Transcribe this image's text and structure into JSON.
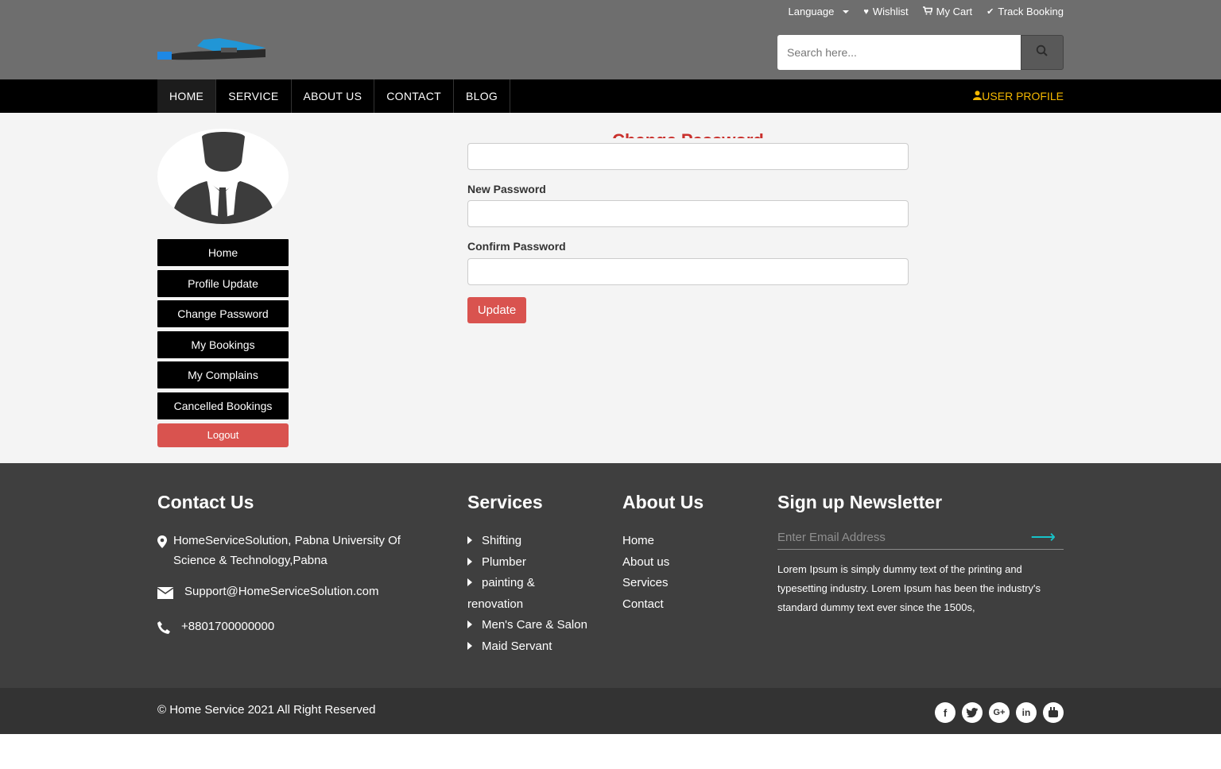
{
  "header": {
    "top_links": [
      {
        "label": "Language",
        "icon": "chevron-down-icon"
      },
      {
        "label": "Wishlist",
        "icon": "heart-icon"
      },
      {
        "label": "My Cart",
        "icon": "cart-icon"
      },
      {
        "label": "Track Booking",
        "icon": "check-icon"
      }
    ],
    "search": {
      "placeholder": "Search here...",
      "icon": "search-icon"
    }
  },
  "nav": {
    "items": [
      "HOME",
      "SERVICE",
      "ABOUT US",
      "CONTACT",
      "BLOG"
    ],
    "user_profile": "USER PROFILE"
  },
  "sidebar": {
    "items": [
      "Home",
      "Profile Update",
      "Change Password",
      "My Bookings",
      "My Complains",
      "Cancelled Bookings"
    ],
    "logout": "Logout"
  },
  "form": {
    "title": "Change Password",
    "labels": {
      "new_password": "New Password",
      "confirm_password": "Confirm Password"
    },
    "submit": "Update"
  },
  "footer": {
    "contact": {
      "heading": "Contact Us",
      "address": "HomeServiceSolution, Pabna University Of Science & Technology,Pabna",
      "email": "Support@HomeServiceSolution.com",
      "phone": "+8801700000000"
    },
    "services": {
      "heading": "Services",
      "items": [
        "Shifting",
        "Plumber",
        "painting & renovation",
        "Men's Care & Salon",
        "Maid Servant"
      ]
    },
    "about": {
      "heading": "About Us",
      "items": [
        "Home",
        "About us",
        "Services",
        "Contact"
      ]
    },
    "newsletter": {
      "heading": "Sign up Newsletter",
      "placeholder": "Enter Email Address",
      "description": "Lorem Ipsum is simply dummy text of the printing and typesetting industry. Lorem Ipsum has been the industry's standard dummy text ever since the 1500s,"
    },
    "copyright": "© Home Service 2021 All Right Reserved",
    "socials": [
      "facebook-icon",
      "twitter-icon",
      "google-plus-icon",
      "linkedin-icon",
      "youtube-icon"
    ]
  },
  "colors": {
    "topbar": "#6e6e6e",
    "navbar": "#000000",
    "accent_red": "#d9534f",
    "user_profile": "#f5b800",
    "footer": "#3f3f3f",
    "arrow": "#17c3c9"
  }
}
